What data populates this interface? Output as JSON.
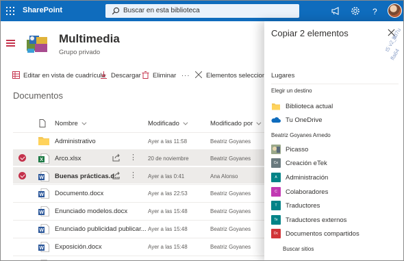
{
  "suitebar": {
    "brand": "SharePoint",
    "search_placeholder": "Buscar en esta biblioteca",
    "icons": [
      "waffle-icon",
      "search-icon",
      "megaphone-icon",
      "gear-icon",
      "help-icon",
      "avatar"
    ]
  },
  "site": {
    "title": "Multimedia",
    "subtitle": "Grupo privado"
  },
  "commands": {
    "edit_grid": "Editar en vista de cuadrícula",
    "download": "Descargar",
    "delete": "Eliminar",
    "more": "···",
    "selected": "Elementos seleccionad"
  },
  "library": {
    "heading": "Documentos",
    "columns": [
      "Nombre",
      "Modificado",
      "Modificado por"
    ],
    "rows": [
      {
        "name": "Administrativo",
        "type": "folder",
        "modified": "Ayer a las 11:58",
        "by": "Beatriz Goyanes",
        "selected": false
      },
      {
        "name": "Arco.xlsx",
        "type": "xlsx",
        "modified": "20 de noviembre",
        "by": "Beatriz Goyanes",
        "selected": true
      },
      {
        "name": "Buenas prácticas.d...",
        "type": "docx",
        "modified": "Ayer a las 0:41",
        "by": "Ana Alonso",
        "selected": true
      },
      {
        "name": "Documento.docx",
        "type": "docx",
        "modified": "Ayer a las 22:53",
        "by": "Beatriz Goyanes",
        "selected": false
      },
      {
        "name": "Enunciado modelos.docx",
        "type": "docx",
        "modified": "Ayer a las 15:48",
        "by": "Beatriz Goyanes",
        "selected": false
      },
      {
        "name": "Enunciado publicidad publicar...",
        "type": "docx",
        "modified": "Ayer a las 15:48",
        "by": "Beatriz Goyanes",
        "selected": false
      },
      {
        "name": "Exposición.docx",
        "type": "docx",
        "modified": "Ayer a las 15:48",
        "by": "Beatriz Goyanes",
        "selected": false
      },
      {
        "name": "",
        "type": "docx",
        "modified": "",
        "by": "",
        "selected": false
      }
    ]
  },
  "panel": {
    "title": "Copiar 2 elementos",
    "watermark": [
      "bd7u",
      "t5 v2_8",
      "ffa64"
    ],
    "section": "Lugares",
    "choose": "Elegir un destino",
    "current_library": "Biblioteca actual",
    "onedrive": "Tu OneDrive",
    "user": "Beatriz Goyanes Arnedo",
    "sites": [
      {
        "label": "Picasso",
        "abbr": "",
        "color": "#9aa88a"
      },
      {
        "label": "Creación eTek",
        "abbr": "Ce",
        "color": "#69797e"
      },
      {
        "label": "Administración",
        "abbr": "A",
        "color": "#038387"
      },
      {
        "label": "Colaboradores",
        "abbr": "C",
        "color": "#c239b3"
      },
      {
        "label": "Traductores",
        "abbr": "T",
        "color": "#038387"
      },
      {
        "label": "Traductores externos",
        "abbr": "Te",
        "color": "#038387"
      },
      {
        "label": "Documentos compartidos",
        "abbr": "Dc",
        "color": "#d13438"
      }
    ],
    "find_sites": "Buscar sitios"
  },
  "colors": {
    "suitebar": "#0f6cbd",
    "accent": "#c4314b",
    "selected_row": "#edebe9"
  }
}
